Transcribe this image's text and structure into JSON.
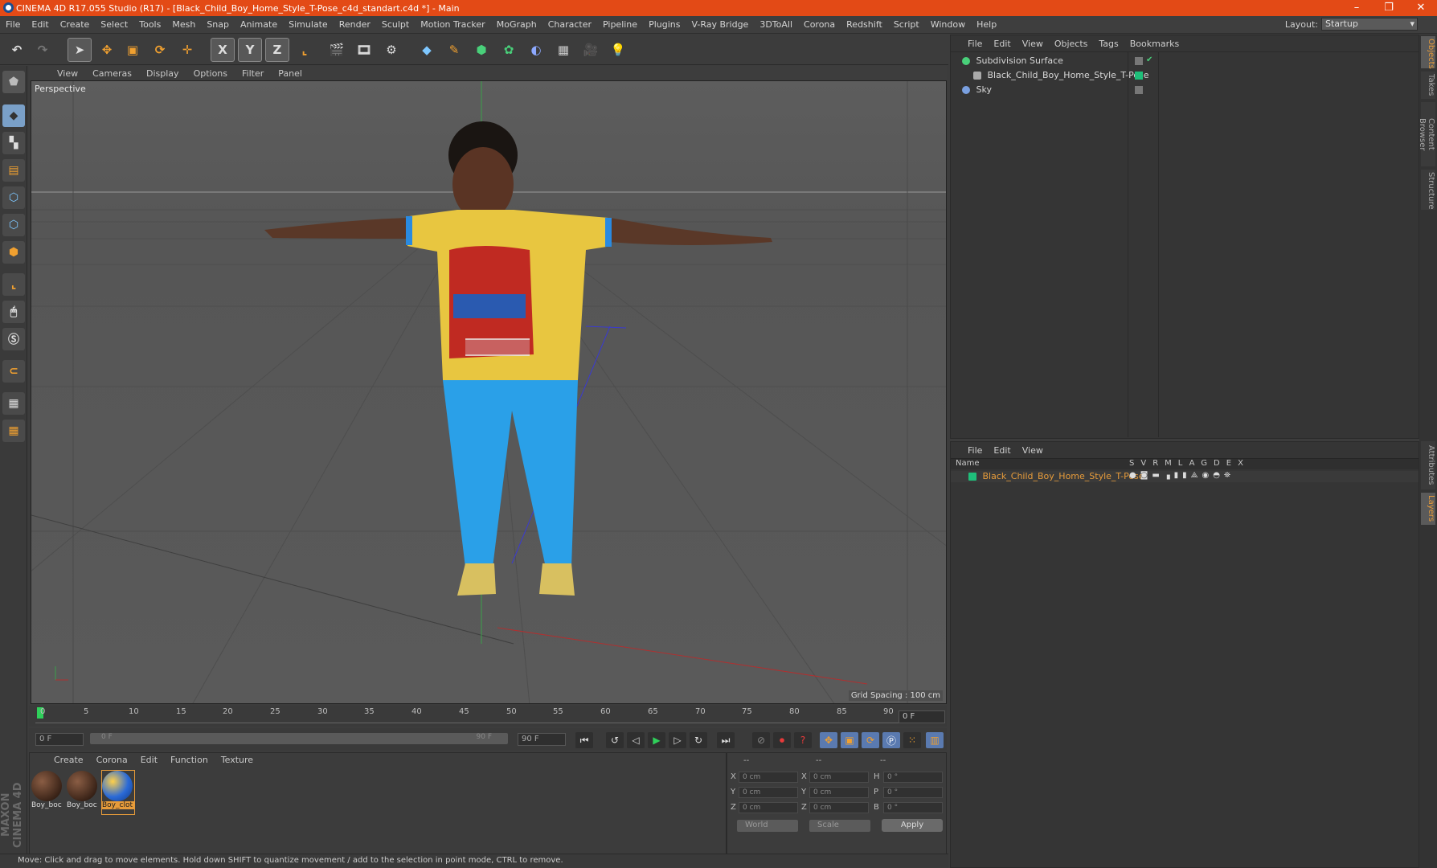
{
  "window": {
    "title": "CINEMA 4D R17.055 Studio (R17) - [Black_Child_Boy_Home_Style_T-Pose_c4d_standart.c4d *] - Main",
    "minimize": "–",
    "maximize": "❐",
    "close": "✕"
  },
  "menu": [
    "File",
    "Edit",
    "Create",
    "Select",
    "Tools",
    "Mesh",
    "Snap",
    "Animate",
    "Simulate",
    "Render",
    "Sculpt",
    "Motion Tracker",
    "MoGraph",
    "Character",
    "Pipeline",
    "Plugins",
    "V-Ray Bridge",
    "3DToAll",
    "Corona",
    "Redshift",
    "Script",
    "Window",
    "Help"
  ],
  "layout": {
    "label": "Layout:",
    "value": "Startup"
  },
  "toolbar": {
    "x_label": "X",
    "y_label": "Y",
    "z_label": "Z"
  },
  "viewport": {
    "menu": [
      "View",
      "Cameras",
      "Display",
      "Options",
      "Filter",
      "Panel"
    ],
    "label": "Perspective",
    "grid_spacing": "Grid Spacing : 100 cm"
  },
  "timeline": {
    "ticks": [
      "0",
      "5",
      "10",
      "15",
      "20",
      "25",
      "30",
      "35",
      "40",
      "45",
      "50",
      "55",
      "60",
      "65",
      "70",
      "75",
      "80",
      "85",
      "90"
    ],
    "end_field": "0 F"
  },
  "transport": {
    "start": "0 F",
    "range_start": "0 F",
    "range_end": "90 F",
    "end": "90 F"
  },
  "material_manager": {
    "menu": [
      "Create",
      "Corona",
      "Edit",
      "Function",
      "Texture"
    ],
    "materials": [
      "Boy_boc",
      "Boy_boc",
      "Boy_clot"
    ]
  },
  "coords": {
    "headers": [
      "--",
      "--",
      "--"
    ],
    "rows": [
      {
        "a": "X",
        "av": "0 cm",
        "b": "X",
        "bv": "0 cm",
        "c": "H",
        "cv": "0 °"
      },
      {
        "a": "Y",
        "av": "0 cm",
        "b": "Y",
        "bv": "0 cm",
        "c": "P",
        "cv": "0 °"
      },
      {
        "a": "Z",
        "av": "0 cm",
        "b": "Z",
        "bv": "0 cm",
        "c": "B",
        "cv": "0 °"
      }
    ],
    "world": "World",
    "scale": "Scale",
    "apply": "Apply"
  },
  "status": "Move: Click and drag to move elements. Hold down SHIFT to quantize movement / add to the selection in point mode, CTRL to remove.",
  "object_manager": {
    "menu": [
      "File",
      "Edit",
      "View",
      "Objects",
      "Tags",
      "Bookmarks"
    ],
    "objects": [
      "Subdivision Surface",
      "Black_Child_Boy_Home_Style_T-Pose",
      "Sky"
    ]
  },
  "layer_manager": {
    "menu": [
      "File",
      "Edit",
      "View"
    ],
    "name_header": "Name",
    "columns": [
      "S",
      "V",
      "R",
      "M",
      "L",
      "A",
      "G",
      "D",
      "E",
      "X"
    ],
    "layer": "Black_Child_Boy_Home_Style_T-Pose"
  },
  "side_tabs": [
    "Objects",
    "Takes",
    "Content Browser",
    "Structure",
    "Attributes",
    "Layers"
  ],
  "logo": "MAXON CINEMA 4D",
  "colors": {
    "accent": "#e34a16",
    "highlight": "#e69b3a",
    "layer_green": "#1fbf7a"
  }
}
